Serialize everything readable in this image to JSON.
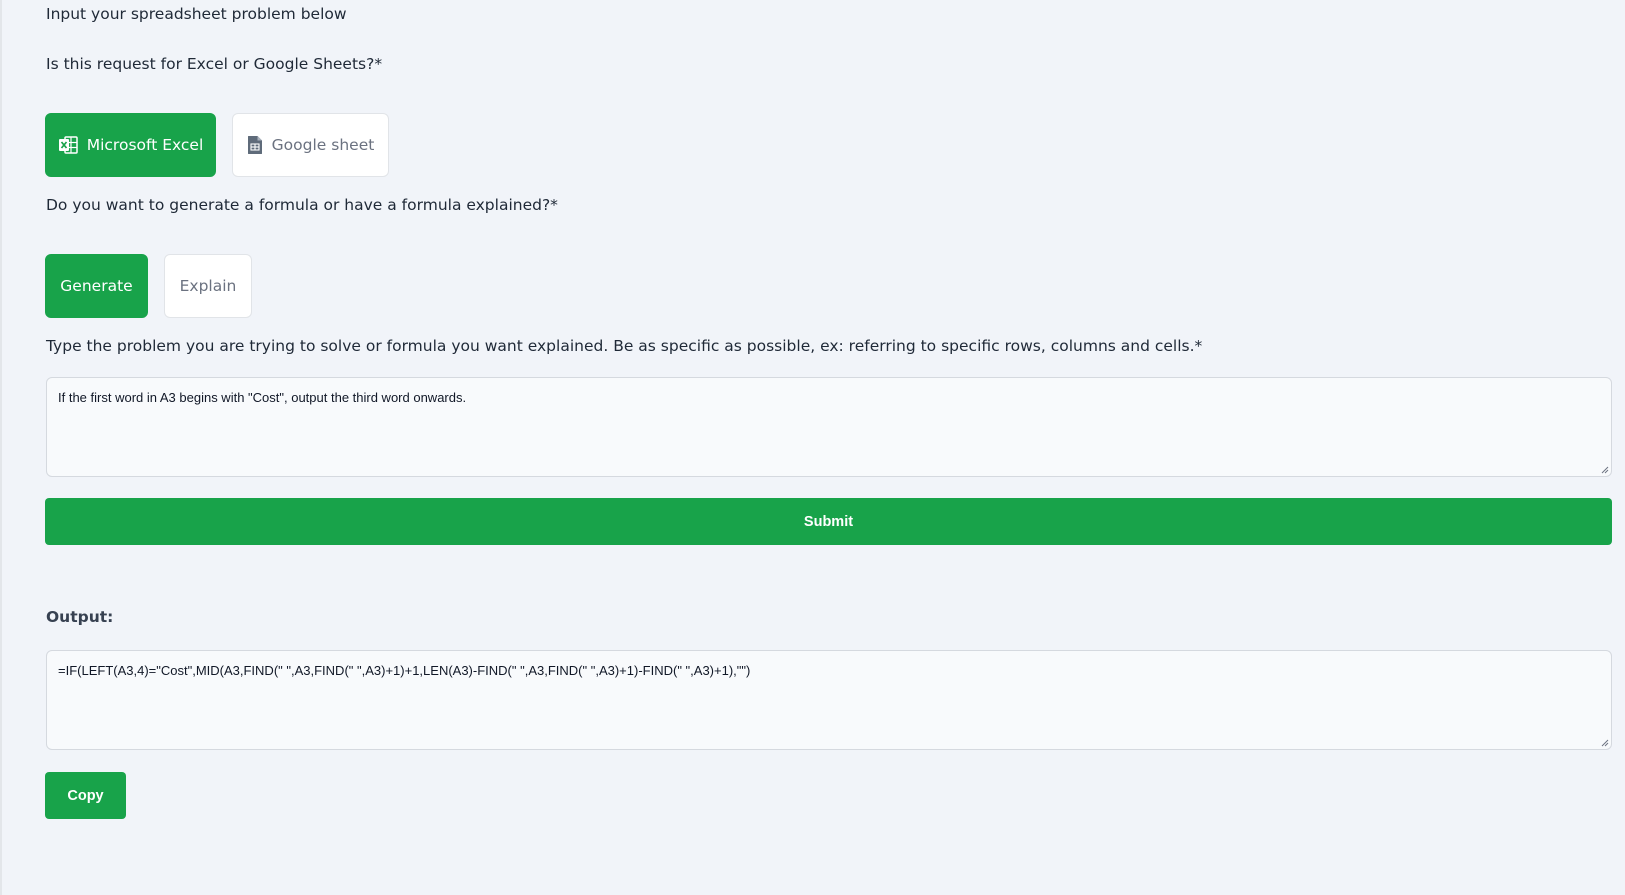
{
  "intro_text": "Input your spreadsheet problem below",
  "platform": {
    "question": "Is this request for Excel or Google Sheets?*",
    "excel_label": "Microsoft Excel",
    "excel_icon": "excel-icon",
    "sheets_label": "Google sheet",
    "sheets_icon": "google-sheets-icon",
    "selected": "Microsoft Excel"
  },
  "mode": {
    "question": "Do you want to generate a formula or have a formula explained?*",
    "generate_label": "Generate",
    "explain_label": "Explain",
    "selected": "Generate"
  },
  "problem": {
    "question": "Type the problem you are trying to solve or formula you want explained. Be as specific as possible, ex: referring to specific rows, columns and cells.*",
    "value": "If the first word in A3 begins with \"Cost\", output the third word onwards."
  },
  "submit_label": "Submit",
  "output": {
    "title": "Output:",
    "value": "=IF(LEFT(A3,4)=\"Cost\",MID(A3,FIND(\" \",A3,FIND(\" \",A3)+1)+1,LEN(A3)-FIND(\" \",A3,FIND(\" \",A3)+1)-FIND(\" \",A3)+1),\"\")",
    "copy_label": "Copy"
  },
  "colors": {
    "accent": "#18a34a",
    "background": "#f1f4f9",
    "input_bg": "#f8fafc"
  }
}
